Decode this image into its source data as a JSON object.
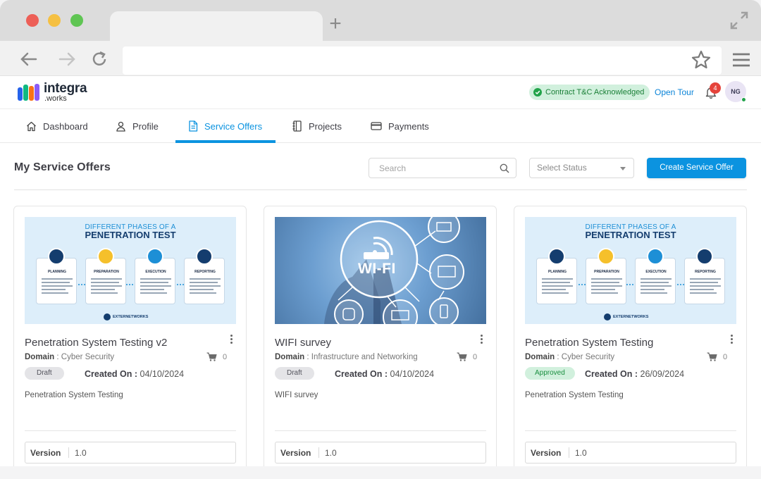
{
  "header": {
    "logo_name": "integra",
    "logo_sub": ".works",
    "tc_badge": "Contract T&C Acknowledged",
    "open_tour": "Open Tour",
    "notification_count": "4",
    "avatar_initials": "NG"
  },
  "nav": {
    "tabs": [
      {
        "label": "Dashboard",
        "icon": "home-icon"
      },
      {
        "label": "Profile",
        "icon": "user-icon"
      },
      {
        "label": "Service Offers",
        "icon": "document-icon",
        "active": true
      },
      {
        "label": "Projects",
        "icon": "notebook-icon"
      },
      {
        "label": "Payments",
        "icon": "credit-card-icon"
      }
    ]
  },
  "page": {
    "title": "My Service Offers",
    "search_placeholder": "Search",
    "status_placeholder": "Select Status",
    "create_label": "Create Service Offer"
  },
  "colors": {
    "accent": "#0b93e0",
    "approved_bg": "#d1f0dd",
    "approved_text": "#1a8f40",
    "draft_bg": "#e4e4e7"
  },
  "cards": [
    {
      "image": {
        "title_line1": "DIFFERENT PHASES OF A",
        "title_line2": "PENETRATION TEST",
        "phases": [
          "PLANNING",
          "PREPARATION",
          "EXECUTION",
          "REPORTING"
        ],
        "brand": "EXTERNETWORKS"
      },
      "title": "Penetration System Testing v2",
      "domain_label": "Domain",
      "domain": "Cyber Security",
      "cart_count": "0",
      "status": "Draft",
      "created_label": "Created On :",
      "created_on": "04/10/2024",
      "description": "Penetration System Testing",
      "version_label": "Version",
      "version": "1.0"
    },
    {
      "image": {
        "label": "WI-FI"
      },
      "title": "WIFI survey",
      "domain_label": "Domain",
      "domain": "Infrastructure and Networking",
      "cart_count": "0",
      "status": "Draft",
      "created_label": "Created On :",
      "created_on": "04/10/2024",
      "description": "WIFI survey",
      "version_label": "Version",
      "version": "1.0"
    },
    {
      "image": {
        "title_line1": "DIFFERENT PHASES OF A",
        "title_line2": "PENETRATION TEST",
        "phases": [
          "PLANNING",
          "PREPARATION",
          "EXECUTION",
          "REPORTING"
        ],
        "brand": "EXTERNETWORKS"
      },
      "title": "Penetration System Testing",
      "domain_label": "Domain",
      "domain": "Cyber Security",
      "cart_count": "0",
      "status": "Approved",
      "created_label": "Created On :",
      "created_on": "26/09/2024",
      "description": "Penetration System Testing",
      "version_label": "Version",
      "version": "1.0"
    }
  ]
}
